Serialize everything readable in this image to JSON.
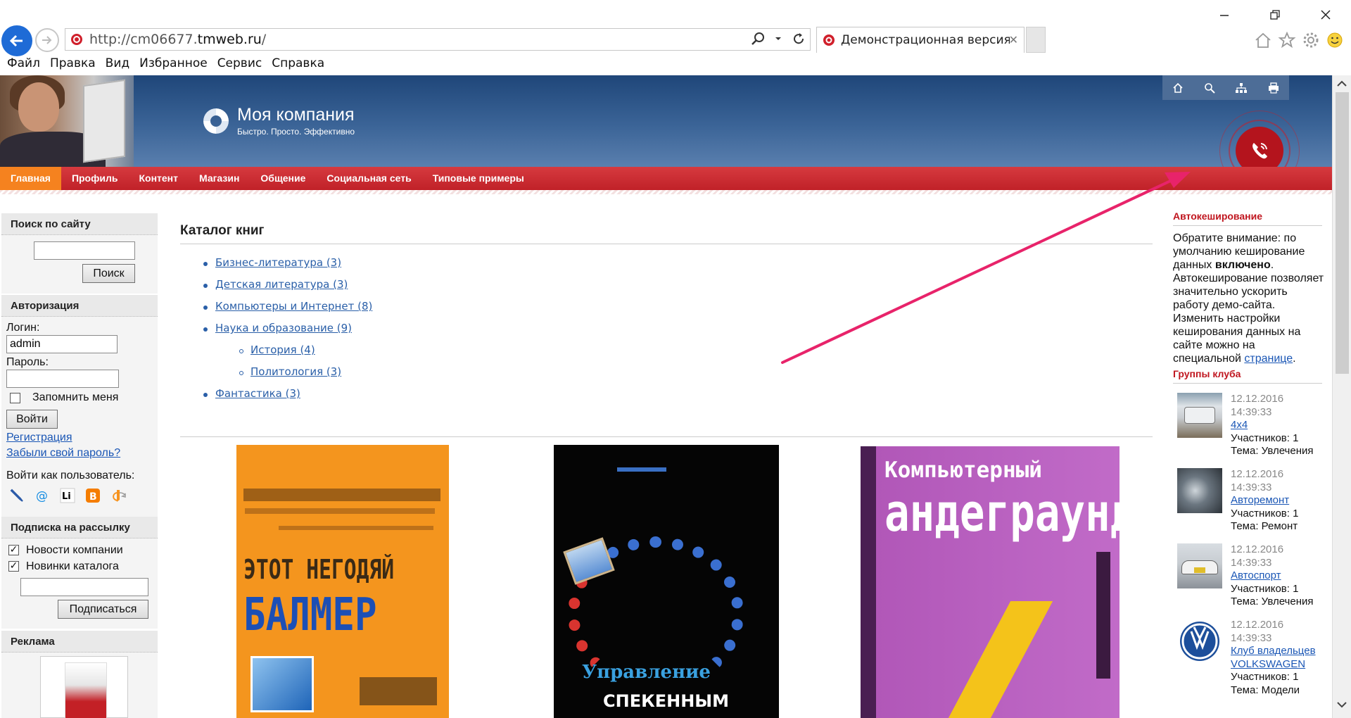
{
  "browser": {
    "url_prefix": "http://cm06677.",
    "url_domain": "tmweb.ru",
    "url_suffix": "/",
    "tab_title": "Демонстрационная версия ...",
    "menu": [
      "Файл",
      "Правка",
      "Вид",
      "Избранное",
      "Сервис",
      "Справка"
    ]
  },
  "header": {
    "company_name": "Моя компания",
    "slogan": "Быстро. Просто. Эффективно"
  },
  "nav": {
    "items": [
      "Главная",
      "Профиль",
      "Контент",
      "Магазин",
      "Общение",
      "Социальная сеть",
      "Типовые примеры"
    ],
    "active_index": 0
  },
  "search": {
    "title": "Поиск по сайту",
    "value": "",
    "button": "Поиск"
  },
  "auth": {
    "title": "Авторизация",
    "login_label": "Логин:",
    "login_value": "admin",
    "password_label": "Пароль:",
    "password_value": "",
    "remember_label": "Запомнить меня",
    "remember_checked": false,
    "login_button": "Войти",
    "register_link": "Регистрация",
    "forgot_link": "Забыли свой пароль?",
    "login_as": "Войти как пользователь:",
    "social_icons": [
      "livejournal-icon",
      "mailru-icon",
      "liveinternet-icon",
      "blogger-icon",
      "openid-icon"
    ]
  },
  "subscribe": {
    "title": "Подписка на рассылку",
    "options": [
      {
        "label": "Новости компании",
        "checked": true
      },
      {
        "label": "Новинки каталога",
        "checked": true
      }
    ],
    "email_value": "",
    "button": "Подписаться"
  },
  "ads": {
    "title": "Реклама"
  },
  "catalog": {
    "title": "Каталог книг",
    "categories": [
      {
        "label": "Бизнес-литература (3)",
        "level": 1
      },
      {
        "label": "Детская литература (3)",
        "level": 1
      },
      {
        "label": "Компьютеры и Интернет (8)",
        "level": 1
      },
      {
        "label": "Наука и образование (9)",
        "level": 1
      },
      {
        "label": "История (4)",
        "level": 2
      },
      {
        "label": "Политология (3)",
        "level": 2
      },
      {
        "label": "Фантастика (3)",
        "level": 1
      }
    ],
    "books": [
      {
        "cover_line1": "ЭТОТ НЕГОДЯЙ",
        "cover_line2": "БАЛМЕР",
        "color": "#f4951e"
      },
      {
        "cover_line1": "Управление",
        "cover_line2": "СПЕКЕННЫМ",
        "color": "#050505"
      },
      {
        "cover_line1": "Компьютерный",
        "cover_line2": "андеграунд",
        "color": "#b157b8"
      }
    ]
  },
  "autocache": {
    "title": "Автокеширование",
    "text_before": "Обратите внимание: по умолчанию кеширование данных ",
    "text_bold": "включено",
    "text_after": ". Автокеширование позволяет значительно ускорить работу демо-сайта. Изменить настройки кеширования данных на сайте можно на специальной ",
    "link": "странице",
    "text_end": "."
  },
  "groups": {
    "title": "Группы клуба",
    "items": [
      {
        "date": "12.12.2016",
        "time": "14:39:33",
        "name": "4x4",
        "members": "Участников: 1",
        "topic": "Тема: Увлечения"
      },
      {
        "date": "12.12.2016",
        "time": "14:39:33",
        "name": "Авторемонт",
        "members": "Участников: 1",
        "topic": "Тема: Ремонт"
      },
      {
        "date": "12.12.2016",
        "time": "14:39:33",
        "name": "Автоспорт",
        "members": "Участников: 1",
        "topic": "Тема: Увлечения"
      },
      {
        "date": "12.12.2016",
        "time": "14:39:33",
        "name": "Клуб владельцев VOLKSWAGEN",
        "members": "Участников: 1",
        "topic": "Тема: Модели"
      }
    ]
  },
  "colors": {
    "nav_red": "#c8262c",
    "nav_active": "#f5821f",
    "header_blue": "#2e5688",
    "link": "#1a56b5",
    "accent_red": "#c0161f",
    "annotation_arrow": "#e8236a"
  }
}
